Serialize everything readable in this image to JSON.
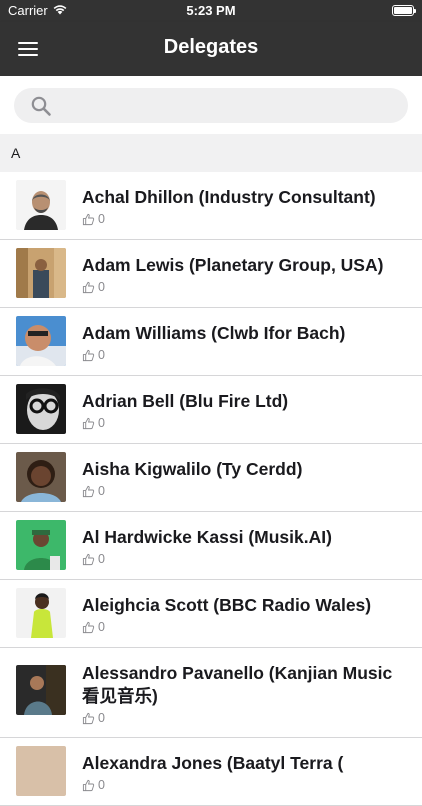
{
  "status_bar": {
    "carrier": "Carrier",
    "time": "5:23 PM"
  },
  "header": {
    "title": "Delegates",
    "menu_icon": "hamburger-menu-icon"
  },
  "search": {
    "placeholder": "",
    "value": "",
    "icon": "search-icon"
  },
  "section": {
    "letter": "A"
  },
  "delegates": [
    {
      "name": "Achal Dhillon (Industry Consultant)",
      "likes": "0"
    },
    {
      "name": "Adam Lewis (Planetary Group, USA)",
      "likes": "0"
    },
    {
      "name": "Adam Williams (Clwb Ifor Bach)",
      "likes": "0"
    },
    {
      "name": "Adrian Bell (Blu Fire Ltd)",
      "likes": "0"
    },
    {
      "name": "Aisha Kigwalilo (Ty Cerdd)",
      "likes": "0"
    },
    {
      "name": "Al Hardwicke Kassi (Musik.AI)",
      "likes": "0"
    },
    {
      "name": "Aleighcia Scott (BBC Radio Wales)",
      "likes": "0"
    },
    {
      "name": "Alessandro Pavanello (Kanjian Music 看见音乐)",
      "likes": "0"
    },
    {
      "name": "Alexandra Jones (Baatyl Terra (",
      "likes": "0"
    }
  ],
  "colors": {
    "bar": "#333333",
    "section_bg": "#f1f1f2",
    "search_bg": "#efeff0",
    "divider": "#d6d6d8"
  }
}
